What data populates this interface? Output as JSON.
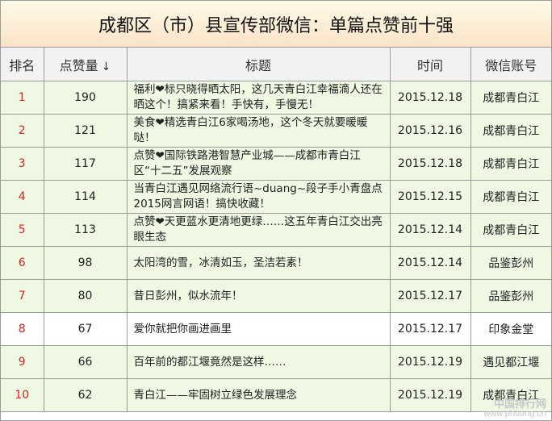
{
  "title": "成都区（市）县宣传部微信：单篇点赞前十强",
  "columns": {
    "rank": "排名",
    "likes": "点赞量",
    "likes_sort": "↓",
    "title": "标题",
    "date": "时间",
    "account": "微信账号"
  },
  "rows": [
    {
      "rank": "1",
      "likes": "190",
      "title": "福利❤标只晓得晒太阳，这几天青白江幸福滴人还在晒这个！搞紧来看！手快有，手慢无！",
      "date": "2015.12.18",
      "account": "成都青白江"
    },
    {
      "rank": "2",
      "likes": "121",
      "title": "美食❤精选青白江6家喝汤地，这个冬天就要暖暖哒！",
      "date": "2015.12.16",
      "account": "成都青白江"
    },
    {
      "rank": "3",
      "likes": "117",
      "title": "点赞❤国际铁路港智慧产业城——成都市青白江区“十二五”发展观察",
      "date": "2015.12.18",
      "account": "成都青白江"
    },
    {
      "rank": "4",
      "likes": "114",
      "title": "当青白江遇见网络流行语~duang~段子手小青盘点2015网言网语！搞快收藏！",
      "date": "2015.12.15",
      "account": "成都青白江"
    },
    {
      "rank": "5",
      "likes": "113",
      "title": "点赞❤天更蓝水更清地更绿……这五年青白江交出亮眼生态",
      "date": "2015.12.14",
      "account": "成都青白江"
    },
    {
      "rank": "6",
      "likes": "98",
      "title": "太阳湾的雪，冰清如玉，圣洁若素！",
      "date": "2015.12.14",
      "account": "品鉴彭州"
    },
    {
      "rank": "7",
      "likes": "80",
      "title": "昔日彭州，似水流年！",
      "date": "2015.12.17",
      "account": "品鉴彭州"
    },
    {
      "rank": "8",
      "likes": "67",
      "title": "爱你就把你画进画里",
      "date": "2015.12.17",
      "account": "印象金堂"
    },
    {
      "rank": "9",
      "likes": "66",
      "title": "百年前的都江堰竟然是这样……",
      "date": "2015.12.19",
      "account": "遇见都江堰"
    },
    {
      "rank": "10",
      "likes": "62",
      "title": "青白江——牢固树立绿色发展理念",
      "date": "2015.12.19",
      "account": "成都青白江"
    }
  ],
  "watermark": {
    "line1": "中国排行网",
    "line2": "www.phbang.cn"
  }
}
